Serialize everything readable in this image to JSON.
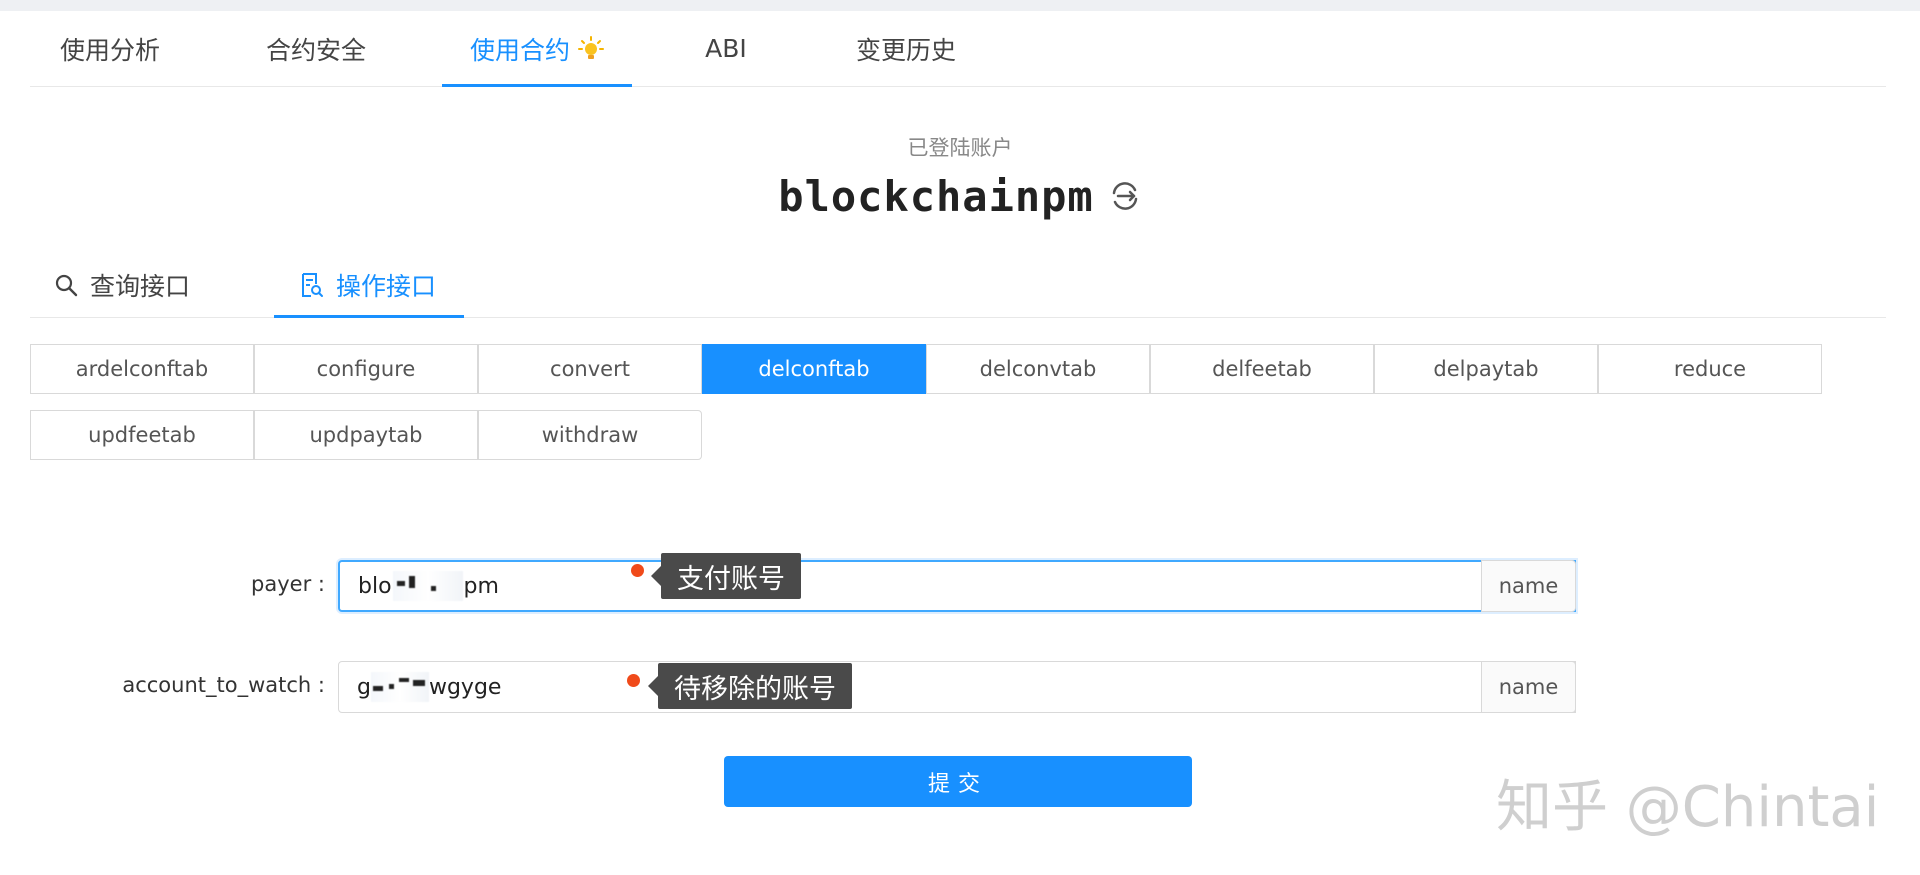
{
  "main_tabs": [
    "使用分析",
    "合约安全",
    "使用合约",
    "ABI",
    "变更历史"
  ],
  "main_tabs_active": "使用合约",
  "account": {
    "label": "已登陆账户",
    "name": "blockchainpm"
  },
  "sub_tabs": {
    "query": "查询接口",
    "action": "操作接口",
    "active": "操作接口"
  },
  "methods": [
    "ardelconftab",
    "configure",
    "convert",
    "delconftab",
    "delconvtab",
    "delfeetab",
    "delpaytab",
    "reduce",
    "updfeetab",
    "updpaytab",
    "withdraw"
  ],
  "methods_active": "delconftab",
  "form": {
    "payer": {
      "label": "payer",
      "value_start": "blo",
      "value_end": "pm",
      "addon": "name",
      "annotation": "支付账号"
    },
    "account_to_watch": {
      "label": "account_to_watch",
      "value_start": "g",
      "value_end": "wgyge",
      "addon": "name",
      "annotation": "待移除的账号"
    },
    "submit_label": "提交"
  },
  "watermark": "知乎 @Chintai",
  "colors": {
    "accent": "#1890ff",
    "annotation_bg": "#4a4a4a",
    "annotation_dot": "#f04a1a"
  }
}
